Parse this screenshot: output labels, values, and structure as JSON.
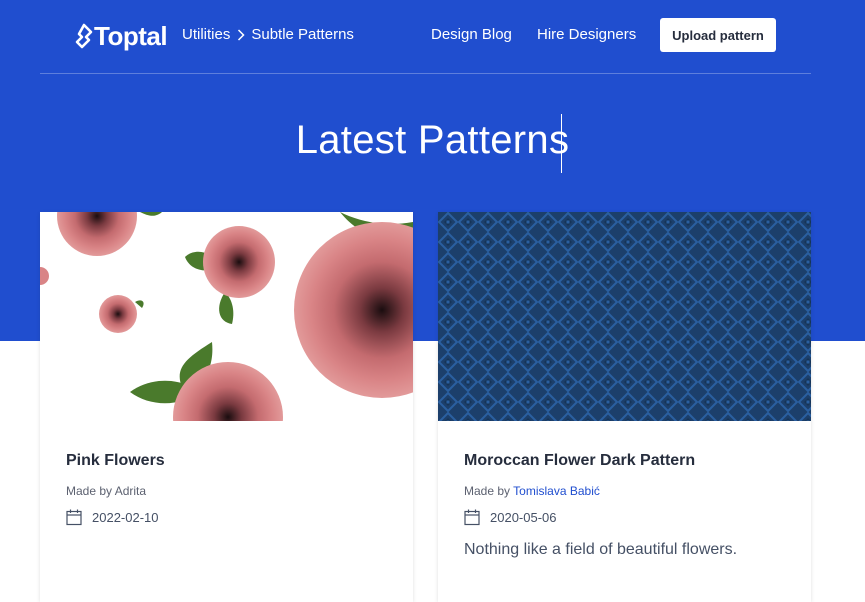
{
  "brand": {
    "name": "Toptal",
    "color": "#204ecf"
  },
  "breadcrumb": {
    "parent": "Utilities",
    "current": "Subtle Patterns"
  },
  "nav": {
    "design_blog": "Design Blog",
    "hire_designers": "Hire Designers",
    "upload_button": "Upload pattern"
  },
  "page_title": "Latest Patterns",
  "patterns": [
    {
      "title": "Pink Flowers",
      "author_prefix": "Made by ",
      "author": "Adrita",
      "date": "2022-02-10",
      "description": "",
      "image": "pink-flowers-pattern"
    },
    {
      "title": "Moroccan Flower Dark Pattern",
      "author_prefix": "Made by ",
      "author": "Tomislava Babić",
      "date": "2020-05-06",
      "description": "Nothing like a field of beautiful flowers.",
      "image": "moroccan-flower-dark-pattern"
    }
  ],
  "icons": {
    "logo": "toptal-logo-icon",
    "breadcrumb_separator": "chevron-right-icon",
    "date": "calendar-icon"
  }
}
